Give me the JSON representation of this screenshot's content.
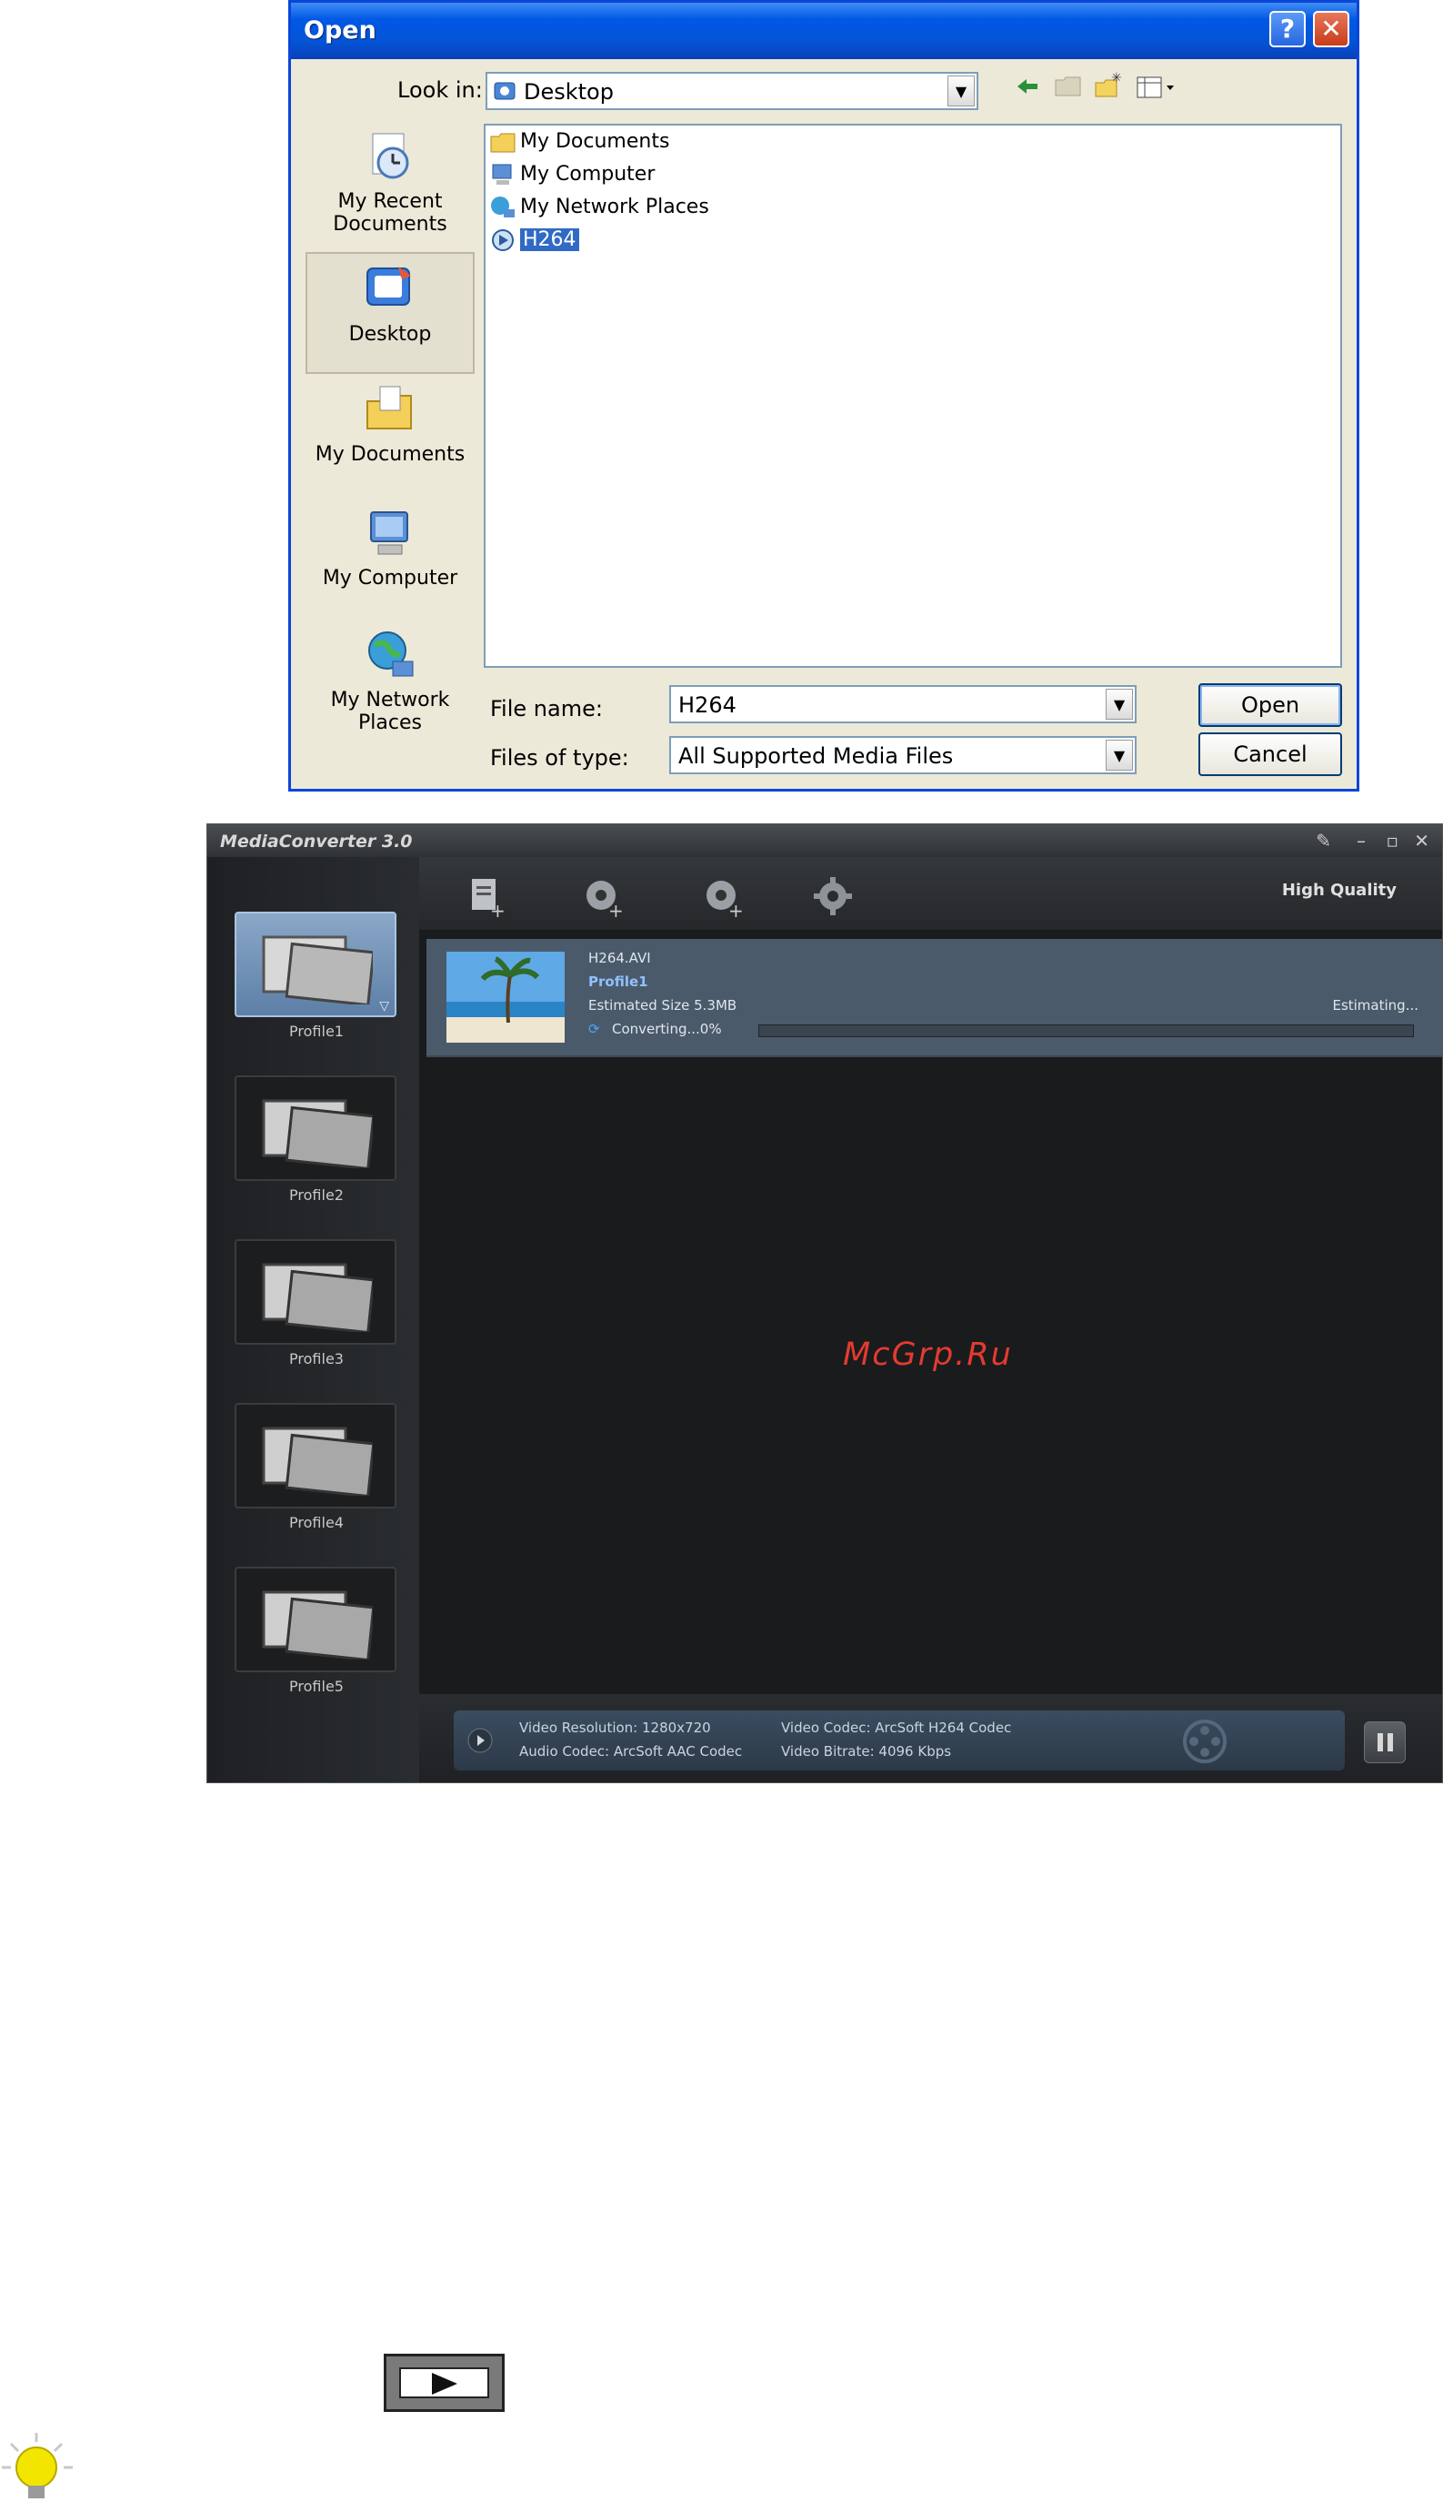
{
  "open_dialog": {
    "title": "Open",
    "look_in_label": "Look in:",
    "look_in_value": "Desktop",
    "places": [
      {
        "label": "My Recent Documents",
        "icon": "recent-documents-icon"
      },
      {
        "label": "Desktop",
        "icon": "desktop-icon"
      },
      {
        "label": "My Documents",
        "icon": "my-documents-icon"
      },
      {
        "label": "My Computer",
        "icon": "my-computer-icon"
      },
      {
        "label": "My Network Places",
        "icon": "network-places-icon"
      }
    ],
    "files": [
      {
        "name": "My Documents",
        "icon": "folder-icon"
      },
      {
        "name": "My Computer",
        "icon": "computer-icon"
      },
      {
        "name": "My Network Places",
        "icon": "network-icon"
      },
      {
        "name": "H264",
        "icon": "media-file-icon",
        "selected": true
      }
    ],
    "file_name_label": "File name:",
    "file_name_value": "H264",
    "file_type_label": "Files of type:",
    "file_type_value": "All Supported Media Files",
    "open_button": "Open",
    "cancel_button": "Cancel"
  },
  "media_converter": {
    "title": "MediaConverter 3.0",
    "quality": "High Quality",
    "profiles": [
      "Profile1",
      "Profile2",
      "Profile3",
      "Profile4",
      "Profile5"
    ],
    "job": {
      "file": "H264.AVI",
      "profile": "Profile1",
      "estimated_size": "Estimated Size 5.3MB",
      "status": "Converting...0%",
      "eta": "Estimating...",
      "progress": 0
    },
    "watermark": "McGrp.Ru",
    "info": {
      "video_resolution": "Video Resolution: 1280x720",
      "audio_codec": "Audio Codec: ArcSoft AAC Codec",
      "video_codec": "Video Codec: ArcSoft H264 Codec",
      "video_bitrate": "Video Bitrate: 4096 Kbps"
    }
  },
  "colors": {
    "xp_title": "#0058e6",
    "xp_face": "#ece9d8",
    "mc_bg": "#1a1b1d",
    "job_bg": "#4b5a6a",
    "watermark": "#e43b30"
  }
}
